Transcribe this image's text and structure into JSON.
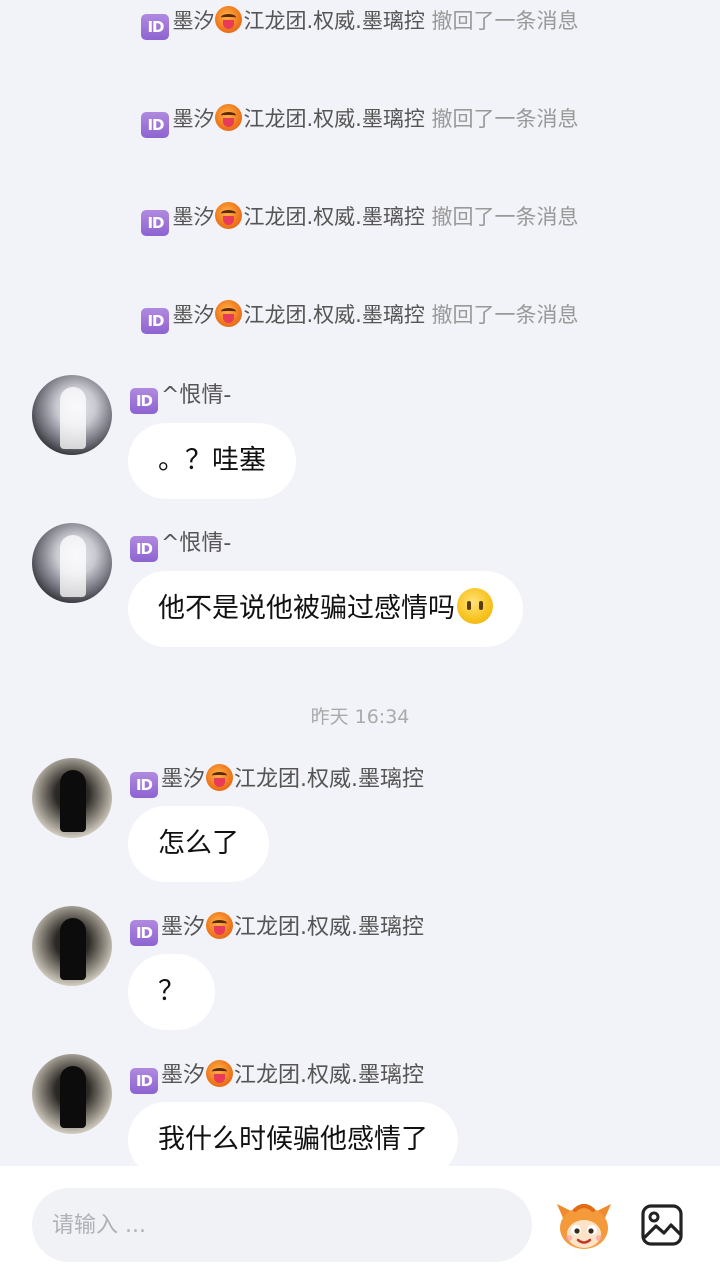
{
  "recalls": [
    {
      "id_badge": "ID",
      "sender": "墨汐",
      "sender_suffix": "江龙团.权威.墨璃控",
      "text": "撤回了一条消息"
    },
    {
      "id_badge": "ID",
      "sender": "墨汐",
      "sender_suffix": "江龙团.权威.墨璃控",
      "text": "撤回了一条消息"
    },
    {
      "id_badge": "ID",
      "sender": "墨汐",
      "sender_suffix": "江龙团.权威.墨璃控",
      "text": "撤回了一条消息"
    },
    {
      "id_badge": "ID",
      "sender": "墨汐",
      "sender_suffix": "江龙团.权威.墨璃控",
      "text": "撤回了一条消息"
    }
  ],
  "messages": [
    {
      "id_badge": "ID",
      "sender": "^恨情-",
      "sender_suffix": "",
      "text": "。？哇塞",
      "avatar": "light",
      "emoji": ""
    },
    {
      "id_badge": "ID",
      "sender": "^恨情-",
      "sender_suffix": "",
      "text": "他不是说他被骗过感情吗",
      "avatar": "light",
      "emoji": "neutral-face"
    },
    {
      "id_badge": "ID",
      "sender": "墨汐",
      "sender_suffix": "江龙团.权威.墨璃控",
      "text": "怎么了",
      "avatar": "dark",
      "emoji": ""
    },
    {
      "id_badge": "ID",
      "sender": "墨汐",
      "sender_suffix": "江龙团.权威.墨璃控",
      "text": "？",
      "avatar": "dark",
      "emoji": ""
    },
    {
      "id_badge": "ID",
      "sender": "墨汐",
      "sender_suffix": "江龙团.权威.墨璃控",
      "text": "我什么时候骗他感情了",
      "avatar": "dark",
      "emoji": ""
    }
  ],
  "timestamp": "昨天 16:34",
  "input": {
    "placeholder": "请输入 ..."
  },
  "icons": {
    "mascot": "mascot-sticker-icon",
    "image": "image-picker-icon"
  },
  "colors": {
    "background": "#f2f3f8",
    "bubble": "#ffffff",
    "id_badge": "#9a70d6"
  }
}
